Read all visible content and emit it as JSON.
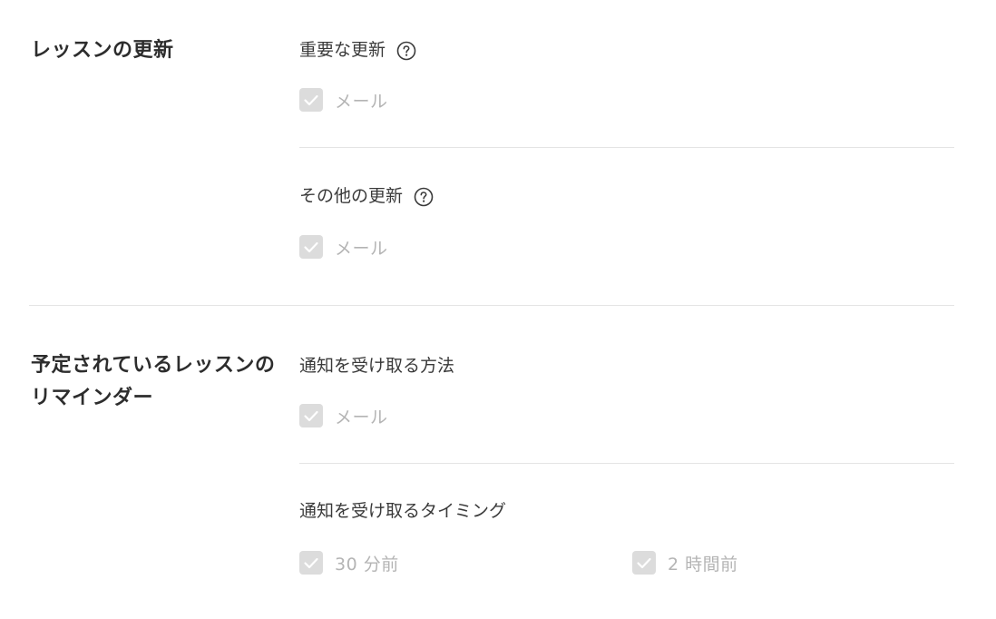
{
  "lesson_updates": {
    "title": "レッスンの更新",
    "important": {
      "label": "重要な更新",
      "help_icon": "question-circle-icon",
      "email_option": {
        "label": "メール",
        "checked": true,
        "disabled": true
      }
    },
    "other": {
      "label": "その他の更新",
      "help_icon": "question-circle-icon",
      "email_option": {
        "label": "メール",
        "checked": true,
        "disabled": true
      }
    }
  },
  "reminders": {
    "title": "予定されているレッスンのリマインダー",
    "method": {
      "label": "通知を受け取る方法",
      "email_option": {
        "label": "メール",
        "checked": true,
        "disabled": true
      }
    },
    "timing": {
      "label": "通知を受け取るタイミング",
      "options": [
        {
          "label": "30 分前",
          "checked": true,
          "disabled": true
        },
        {
          "label": "2 時間前",
          "checked": true,
          "disabled": true
        }
      ]
    }
  },
  "colors": {
    "checkbox_disabled_bg": "#dcdcdc",
    "disabled_text": "#b4b4b4",
    "divider": "#e4e4e4",
    "heading_text": "#2d2d2d"
  }
}
